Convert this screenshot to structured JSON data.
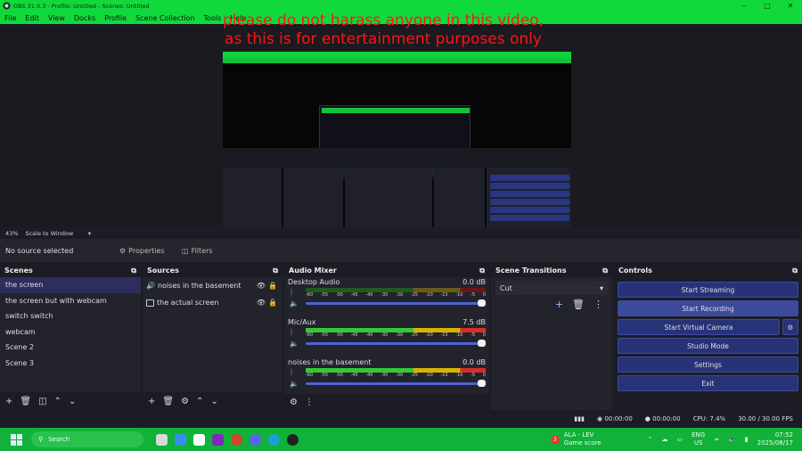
{
  "window": {
    "title": "OBS 31.0.3 - Profile: Untitled - Scenes: Untitled"
  },
  "menu": [
    "File",
    "Edit",
    "View",
    "Docks",
    "Profile",
    "Scene Collection",
    "Tools",
    "Help"
  ],
  "overlay_text": "please do not harass anyone in this video, as this is for entertainment purposes only",
  "preview": {
    "zoom": "43%",
    "scale_mode": "Scale to Window"
  },
  "source_bar": {
    "status": "No source selected",
    "properties": "Properties",
    "filters": "Filters"
  },
  "scenes": {
    "title": "Scenes",
    "items": [
      "the screen",
      "the screen but with webcam",
      "switch switch",
      "webcam",
      "Scene 2",
      "Scene 3"
    ],
    "selected": 0
  },
  "sources": {
    "title": "Sources",
    "items": [
      "noises in the basement",
      "the actual screen"
    ]
  },
  "audio_mixer": {
    "title": "Audio Mixer",
    "ticks": [
      "-60",
      "-55",
      "-50",
      "-45",
      "-40",
      "-35",
      "-30",
      "-25",
      "-20",
      "-15",
      "-10",
      "-5",
      "0"
    ],
    "channels": [
      {
        "name": "Desktop Audio",
        "level": "0.0 dB",
        "active": false,
        "fader": 1.0
      },
      {
        "name": "Mic/Aux",
        "level": "7.5 dB",
        "active": true,
        "fader": 1.0
      },
      {
        "name": "noises in the basement",
        "level": "0.0 dB",
        "active": true,
        "fader": 1.0
      }
    ]
  },
  "transitions": {
    "title": "Scene Transitions",
    "selected": "Cut"
  },
  "controls": {
    "title": "Controls",
    "start_streaming": "Start Streaming",
    "start_recording": "Start Recording",
    "start_virtual_camera": "Start Virtual Camera",
    "studio_mode": "Studio Mode",
    "settings": "Settings",
    "exit": "Exit"
  },
  "status": {
    "stream_time": "00:00:00",
    "rec_time": "00:00:00",
    "cpu": "CPU: 7.4%",
    "fps": "30.00 / 30.00 FPS"
  },
  "taskbar": {
    "search": "Search",
    "game_title": "ALA - LEV",
    "game_sub": "Game score",
    "game_badge": "3",
    "lang": "ENG",
    "region": "US",
    "time": "07:52",
    "date": "2025/08/17"
  }
}
